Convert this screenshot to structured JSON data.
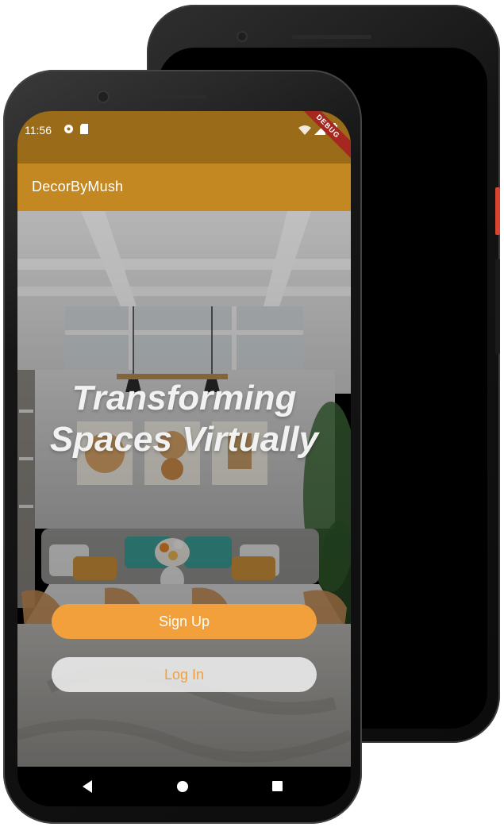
{
  "status_bar": {
    "time": "11:56",
    "debug_banner": "DEBUG"
  },
  "app_bar": {
    "title": "DecorByMush"
  },
  "hero": {
    "headline_line1": "Transforming",
    "headline_line2": "Spaces Virtually"
  },
  "buttons": {
    "signup_label": "Sign Up",
    "login_label": "Log In"
  },
  "colors": {
    "status_bar": "#9a6b18",
    "app_bar": "#c48822",
    "accent": "#f2a03c",
    "debug_ribbon": "#a5271f"
  },
  "icons": {
    "status_left": [
      "settings-status-icon",
      "sd-card-icon"
    ],
    "status_right": [
      "wifi-icon",
      "signal-icon",
      "battery-icon"
    ],
    "navigation": [
      "back-icon",
      "home-icon",
      "recents-icon"
    ]
  }
}
